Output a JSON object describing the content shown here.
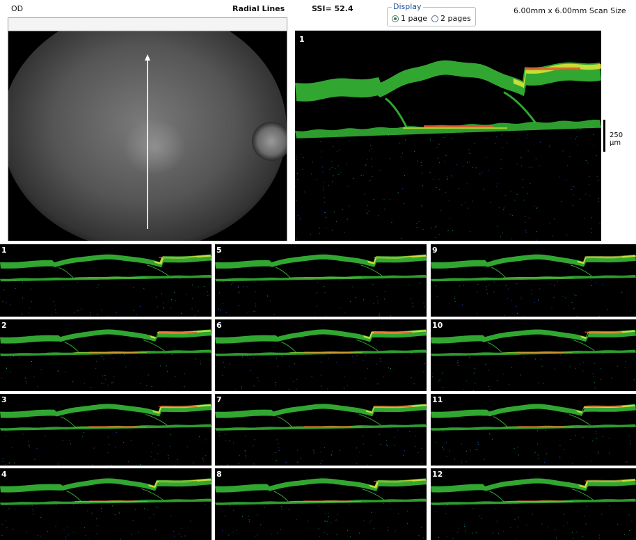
{
  "header": {
    "eye": "OD",
    "scan_type": "Radial Lines",
    "ssi": "SSI= 52.4",
    "scan_size": "6.00mm x 6.00mm Scan Size"
  },
  "display": {
    "legend": "Display",
    "options": [
      {
        "label": "1 page",
        "selected": true
      },
      {
        "label": "2 pages",
        "selected": false
      }
    ]
  },
  "main_scan": {
    "number": "1",
    "scale_label": "250 µm"
  },
  "thumbnails": [
    "1",
    "5",
    "9",
    "2",
    "6",
    "10",
    "3",
    "7",
    "11",
    "4",
    "8",
    "12"
  ],
  "colors": {
    "retina_green": "#39c43a",
    "retina_yellow": "#d9e43a",
    "retina_red": "#e4572a",
    "noise_blue": "#1d4fb8"
  }
}
